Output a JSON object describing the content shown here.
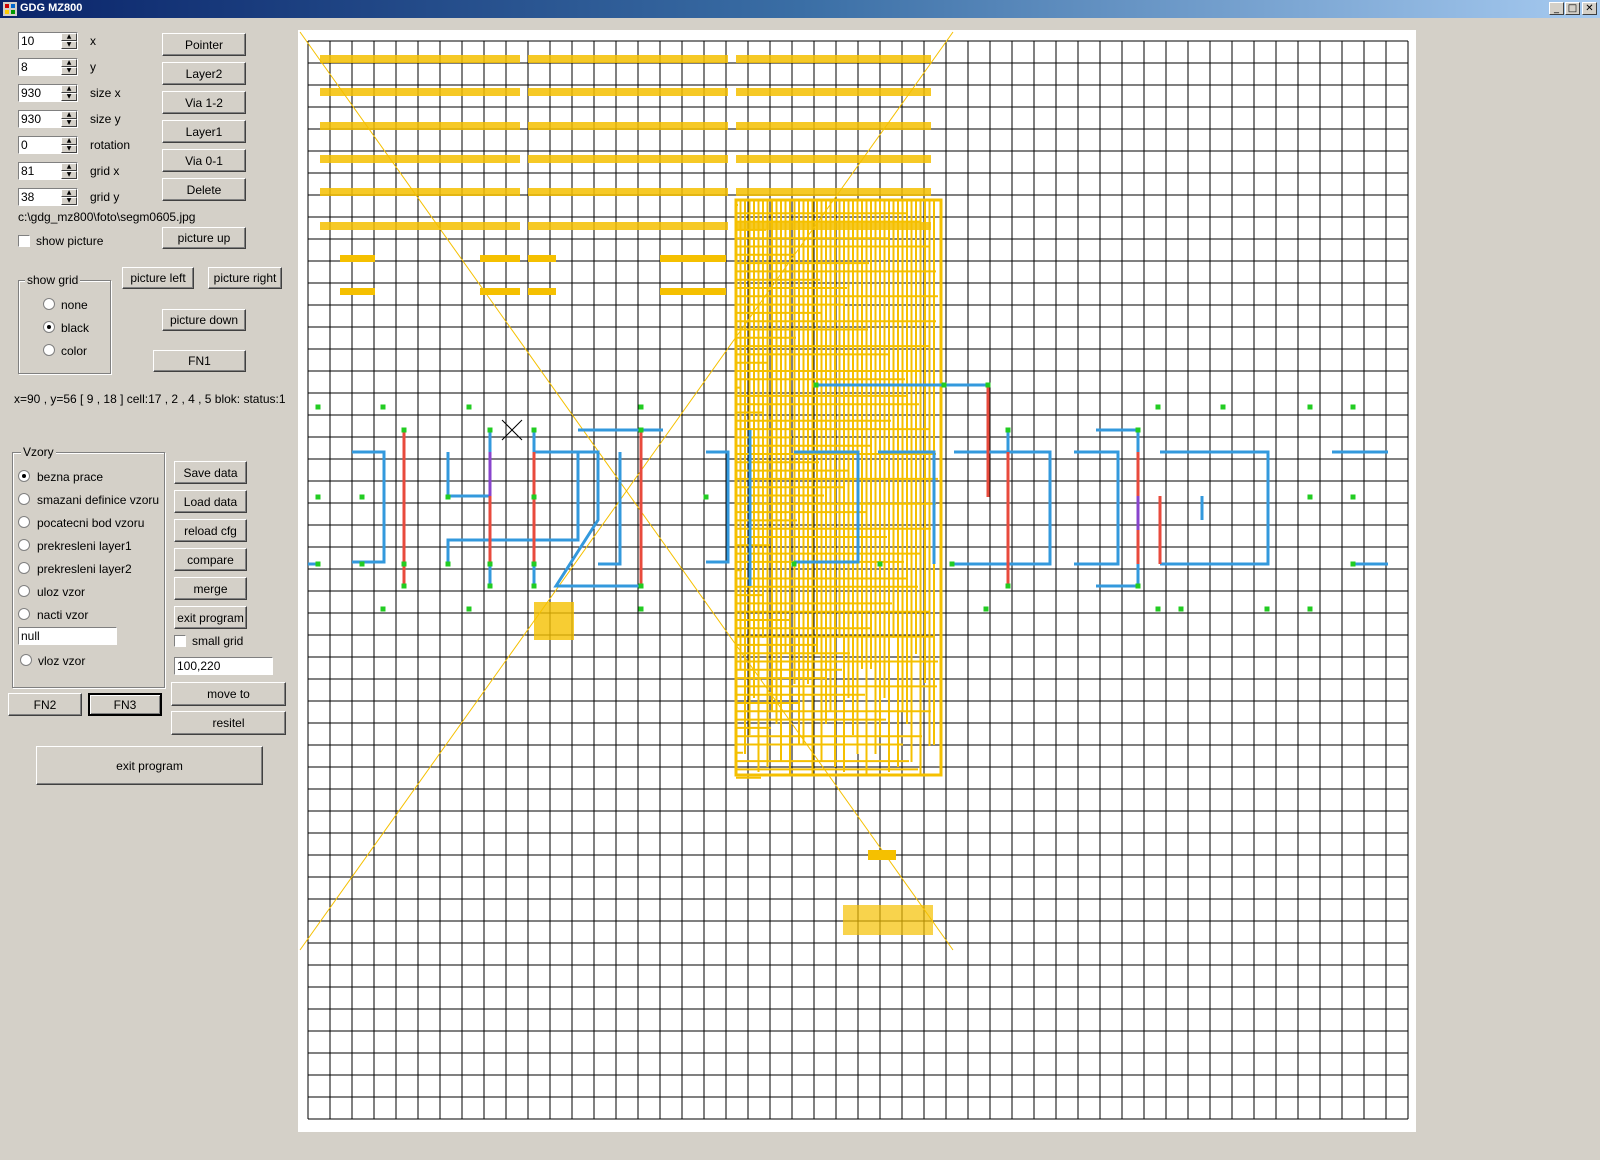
{
  "window": {
    "title": "GDG MZ800",
    "buttons": {
      "minimize": "_",
      "maximize": "□",
      "close": "✕"
    }
  },
  "params": [
    {
      "value": "10",
      "label": "x"
    },
    {
      "value": "8",
      "label": "y"
    },
    {
      "value": "930",
      "label": "size x"
    },
    {
      "value": "930",
      "label": "size y"
    },
    {
      "value": "0",
      "label": "rotation"
    },
    {
      "value": "81",
      "label": "grid x"
    },
    {
      "value": "38",
      "label": "grid y"
    }
  ],
  "tools": [
    "Pointer",
    "Layer2",
    "Via 1-2",
    "Layer1",
    "Via 0-1",
    "Delete"
  ],
  "picture": {
    "path": "c:\\gdg_mz800\\foto\\segm0605.jpg",
    "show_label": "show picture",
    "up": "picture up",
    "left": "picture left",
    "right": "picture right",
    "down": "picture down"
  },
  "grid_group": {
    "title": "show grid",
    "options": [
      "none",
      "black",
      "color"
    ],
    "selected": "black"
  },
  "fn1": "FN1",
  "status_text": "x=90 ,  y=56 [ 9 , 18 ] cell:17 , 2 , 4 , 5 blok: status:1",
  "vzory": {
    "title": "Vzory",
    "options": [
      "bezna prace",
      "smazani definice vzoru",
      "pocatecni bod vzoru",
      "prekresleni layer1",
      "prekresleni layer2",
      "uloz vzor",
      "nacti vzor"
    ],
    "selected": "bezna prace",
    "name_value": "null",
    "insert_label": "vloz vzor"
  },
  "actions": [
    "Save data",
    "Load data",
    "reload cfg",
    "compare",
    "merge",
    "exit program"
  ],
  "small_grid_label": "small grid",
  "coords_value": "100,220",
  "move_to": "move to",
  "resitel": "resitel",
  "fn2": "FN2",
  "fn3": "FN3",
  "exit_big": "exit program",
  "colors": {
    "grid": "#000000",
    "layer1_trace": "#3399dd",
    "layer2_trace": "#e84a3c",
    "via": "#22cc22",
    "picture_overlay": "#f5c000",
    "purple_trace": "#8844cc"
  }
}
